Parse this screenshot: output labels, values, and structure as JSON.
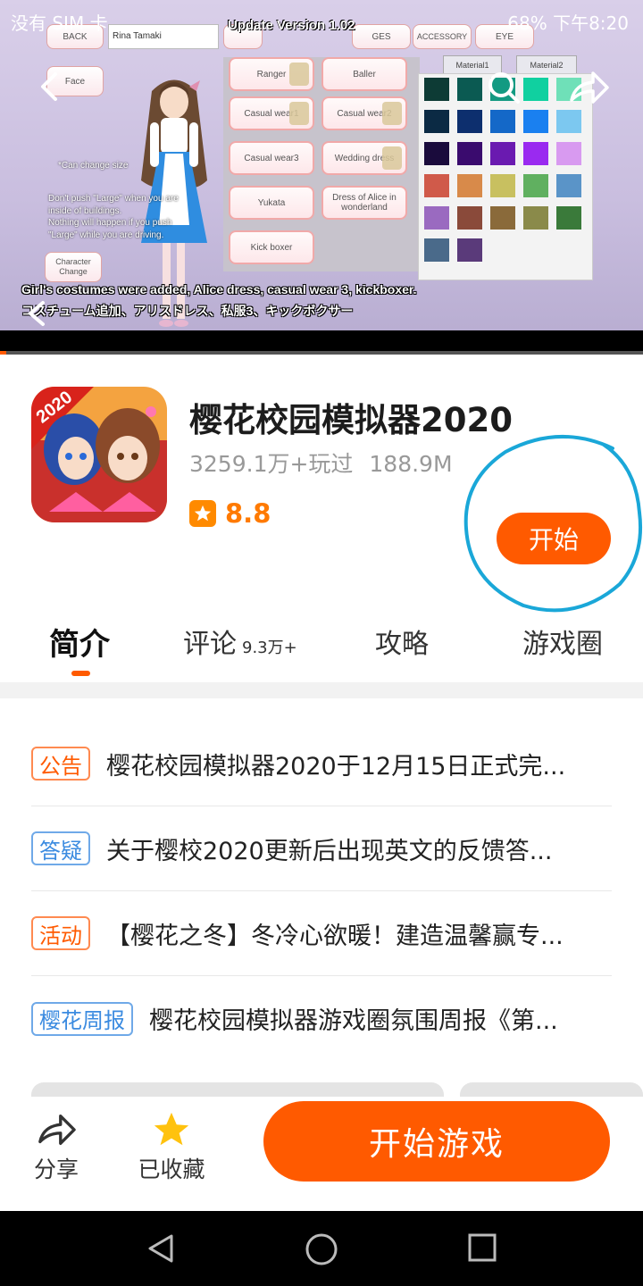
{
  "status_bar": {
    "left": "没有 SIM 卡",
    "right": "68%  下午8:20",
    "video_overlay_title": "Update Version 1.02"
  },
  "video": {
    "buttons": {
      "back": "BACK",
      "name_field": "Rina Tamaki",
      "ges": "GES",
      "accessory": "ACCESSORY",
      "eye": "EYE",
      "face": "Face",
      "character_change": "Character Change"
    },
    "material_tabs": [
      "Material1",
      "Material2"
    ],
    "costumes": [
      "Ranger",
      "Baller",
      "Casual wear1",
      "Casual wear2",
      "Casual wear3",
      "Wedding dress",
      "Yukata",
      "Dress of Alice in wonderland",
      "Kick boxer"
    ],
    "notes": {
      "can_change_size": "*Can change size",
      "warning_1": "Don't push \"Large\" when you are",
      "warning_2": "inside of buildings.",
      "warning_3": "Nothing will happen if you push",
      "warning_4": "\"Large\" while you are driving."
    },
    "caption_en": "Girl's costumes were added, Alice dress, casual wear 3, kickboxer.",
    "caption_jp": "コスチューム追加、アリスドレス、私服3、キックボクサー",
    "swatch_colors": [
      "#0d3b35",
      "#0b5a52",
      "#139a82",
      "#10d0a0",
      "#6fe0b8",
      "#0b2a44",
      "#0d2f6e",
      "#1468c8",
      "#1a80f0",
      "#7cc8f0",
      "#1a0b3c",
      "#3a0b6e",
      "#6a1ab0",
      "#9a2af0",
      "#d89af0",
      "#d05a4a",
      "#d88a4a",
      "#c8c060",
      "#60b060",
      "#5a94c8",
      "#9a6ac0",
      "#8a4a3a",
      "#8a6a3a",
      "#8a8a4a",
      "#3a7a3a",
      "#4a6a8a",
      "#5a3a7a"
    ],
    "progress_fraction": 0.01
  },
  "app": {
    "icon_badge": "2020",
    "title": "樱花校园模拟器2020",
    "plays": "3259.1万+玩过",
    "size": "188.9M",
    "rating": "8.8",
    "start_label": "开始"
  },
  "tabs": [
    {
      "label": "简介",
      "sub": ""
    },
    {
      "label": "评论",
      "sub": "9.3万+"
    },
    {
      "label": "攻略",
      "sub": ""
    },
    {
      "label": "游戏圈",
      "sub": ""
    }
  ],
  "news": [
    {
      "tag": "公告",
      "text": "樱花校园模拟器2020于12月15日正式完..."
    },
    {
      "tag": "答疑",
      "text": "关于樱校2020更新后出现英文的反馈答..."
    },
    {
      "tag": "活动",
      "text": "【樱花之冬】冬冷心欲暖！建造温馨赢专..."
    },
    {
      "tag": "樱花周报",
      "text": "樱花校园模拟器游戏圈氛围周报《第..."
    }
  ],
  "bottom_bar": {
    "share_label": "分享",
    "favorite_label": "已收藏",
    "play_label": "开始游戏"
  },
  "colors": {
    "accent": "#ff5a00",
    "rating": "#ff8a00",
    "tag_blue": "#3b8be0",
    "annotation_circle": "#1aa7d8"
  }
}
